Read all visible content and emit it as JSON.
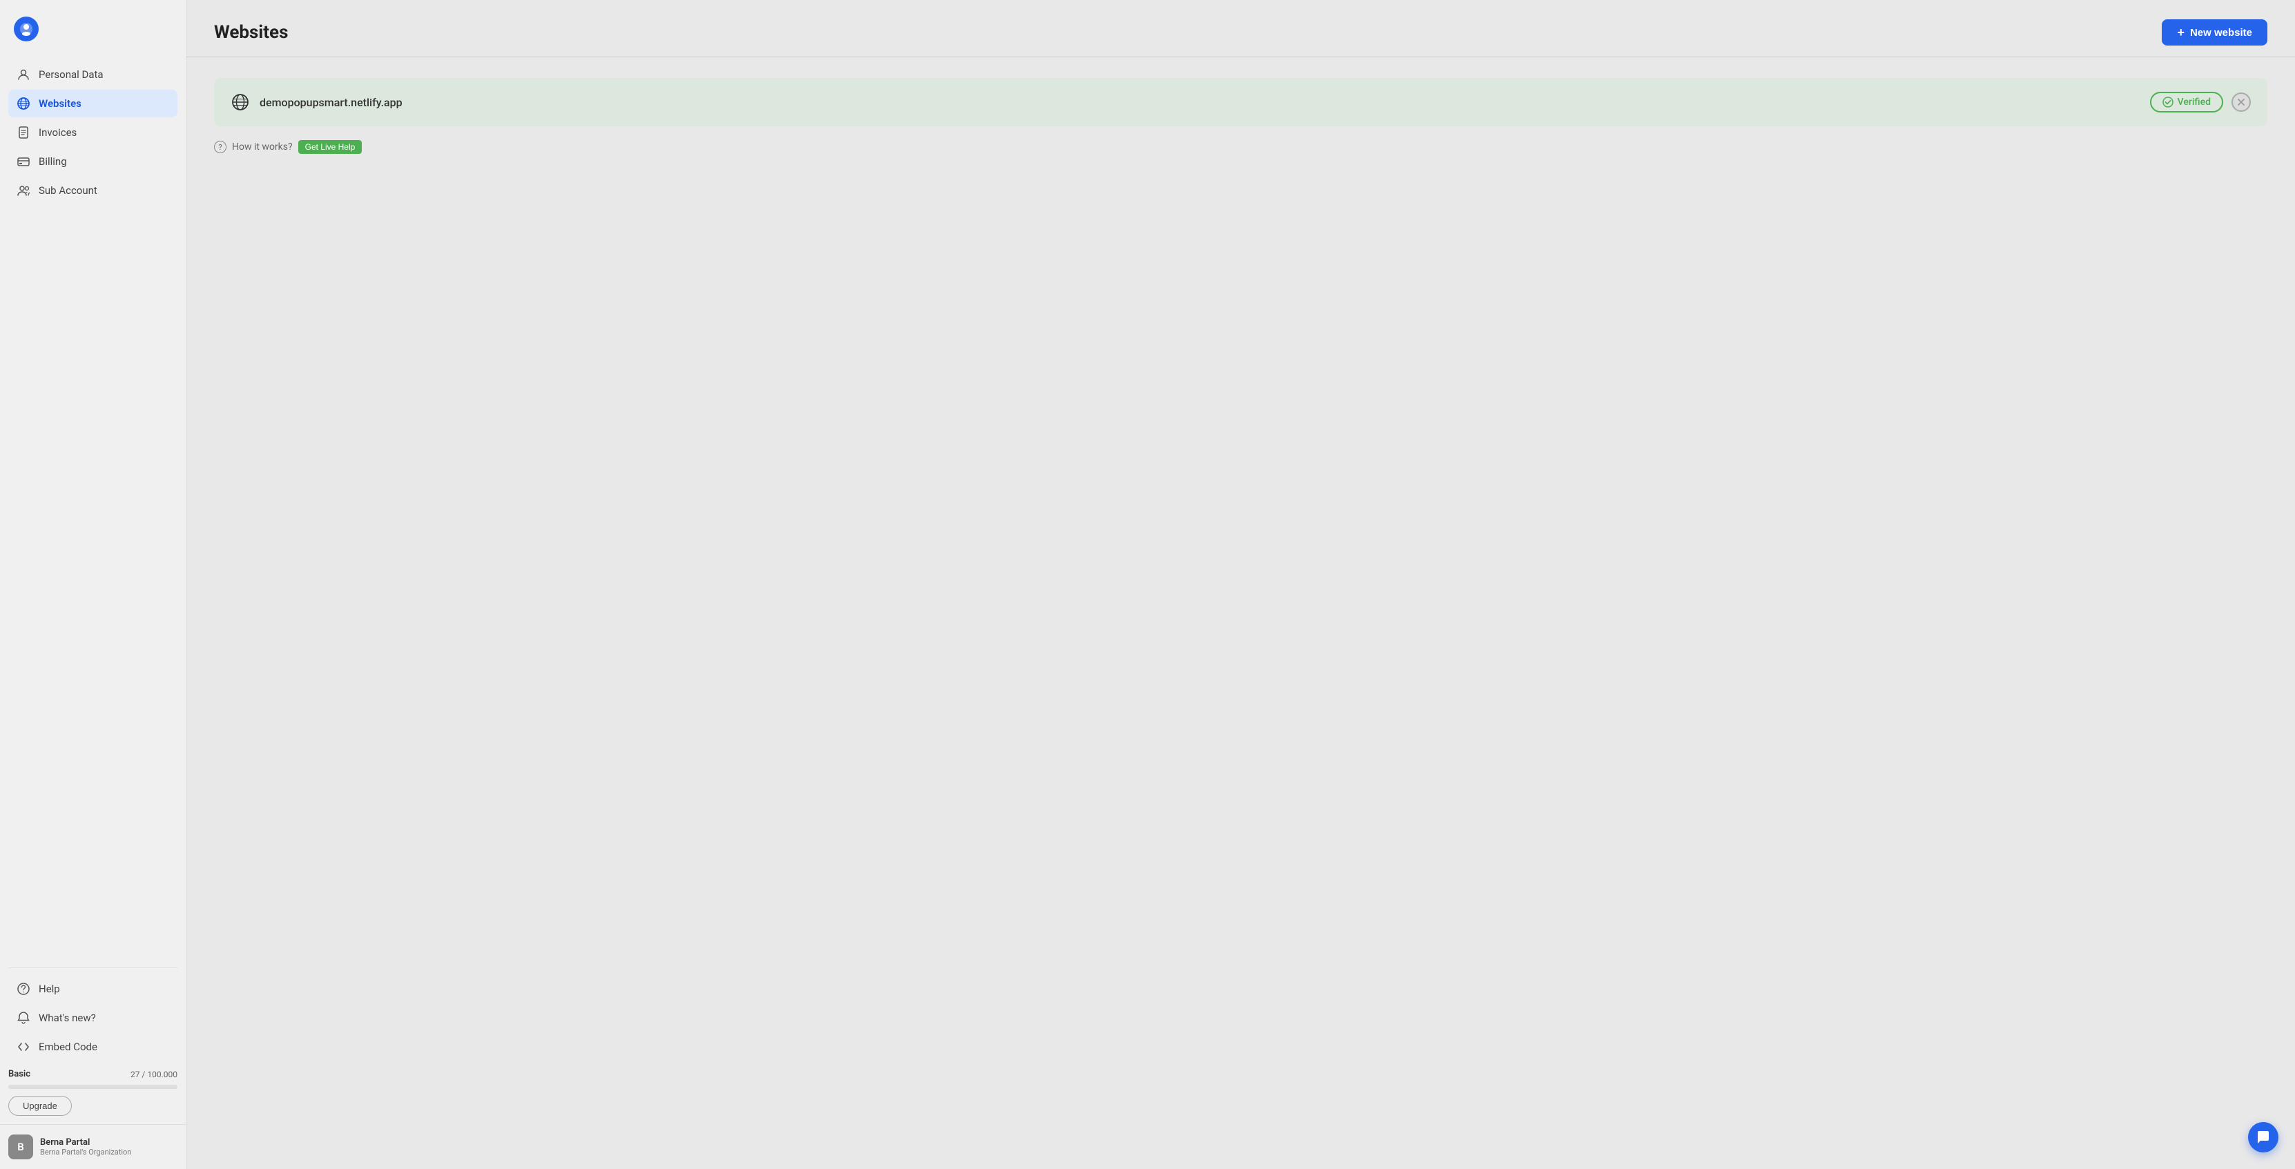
{
  "sidebar": {
    "logo": {
      "symbol": "●",
      "color": "#2563eb"
    },
    "nav_items": [
      {
        "id": "personal-data",
        "label": "Personal Data",
        "icon": "person",
        "active": false
      },
      {
        "id": "websites",
        "label": "Websites",
        "icon": "globe",
        "active": true
      },
      {
        "id": "invoices",
        "label": "Invoices",
        "icon": "document",
        "active": false
      },
      {
        "id": "billing",
        "label": "Billing",
        "icon": "card",
        "active": false
      },
      {
        "id": "sub-account",
        "label": "Sub Account",
        "icon": "people",
        "active": false
      }
    ],
    "bottom_items": [
      {
        "id": "help",
        "label": "Help",
        "icon": "question-circle"
      },
      {
        "id": "whats-new",
        "label": "What's new?",
        "icon": "bell"
      },
      {
        "id": "embed-code",
        "label": "Embed Code",
        "icon": "code-bracket"
      }
    ],
    "plan": {
      "name": "Basic",
      "current": 27,
      "max": 100000,
      "display": "27 / 100.000",
      "upgrade_label": "Upgrade"
    },
    "user": {
      "name": "Berna Partal",
      "organization": "Berna Partal's Organization",
      "avatar_initials": "B"
    }
  },
  "header": {
    "title": "Websites",
    "new_button_label": "New website",
    "new_button_icon": "+"
  },
  "website_card": {
    "url": "demopopupsmart.netlify.app",
    "status": "Verified",
    "status_color": "#4caf50"
  },
  "help_section": {
    "text": "How it works?",
    "live_help_label": "Get Live Help"
  },
  "colors": {
    "brand_blue": "#2563eb",
    "verified_green": "#4caf50",
    "card_bg": "#dce8de",
    "active_nav_bg": "#dce8fb",
    "active_nav_color": "#1a56db"
  }
}
